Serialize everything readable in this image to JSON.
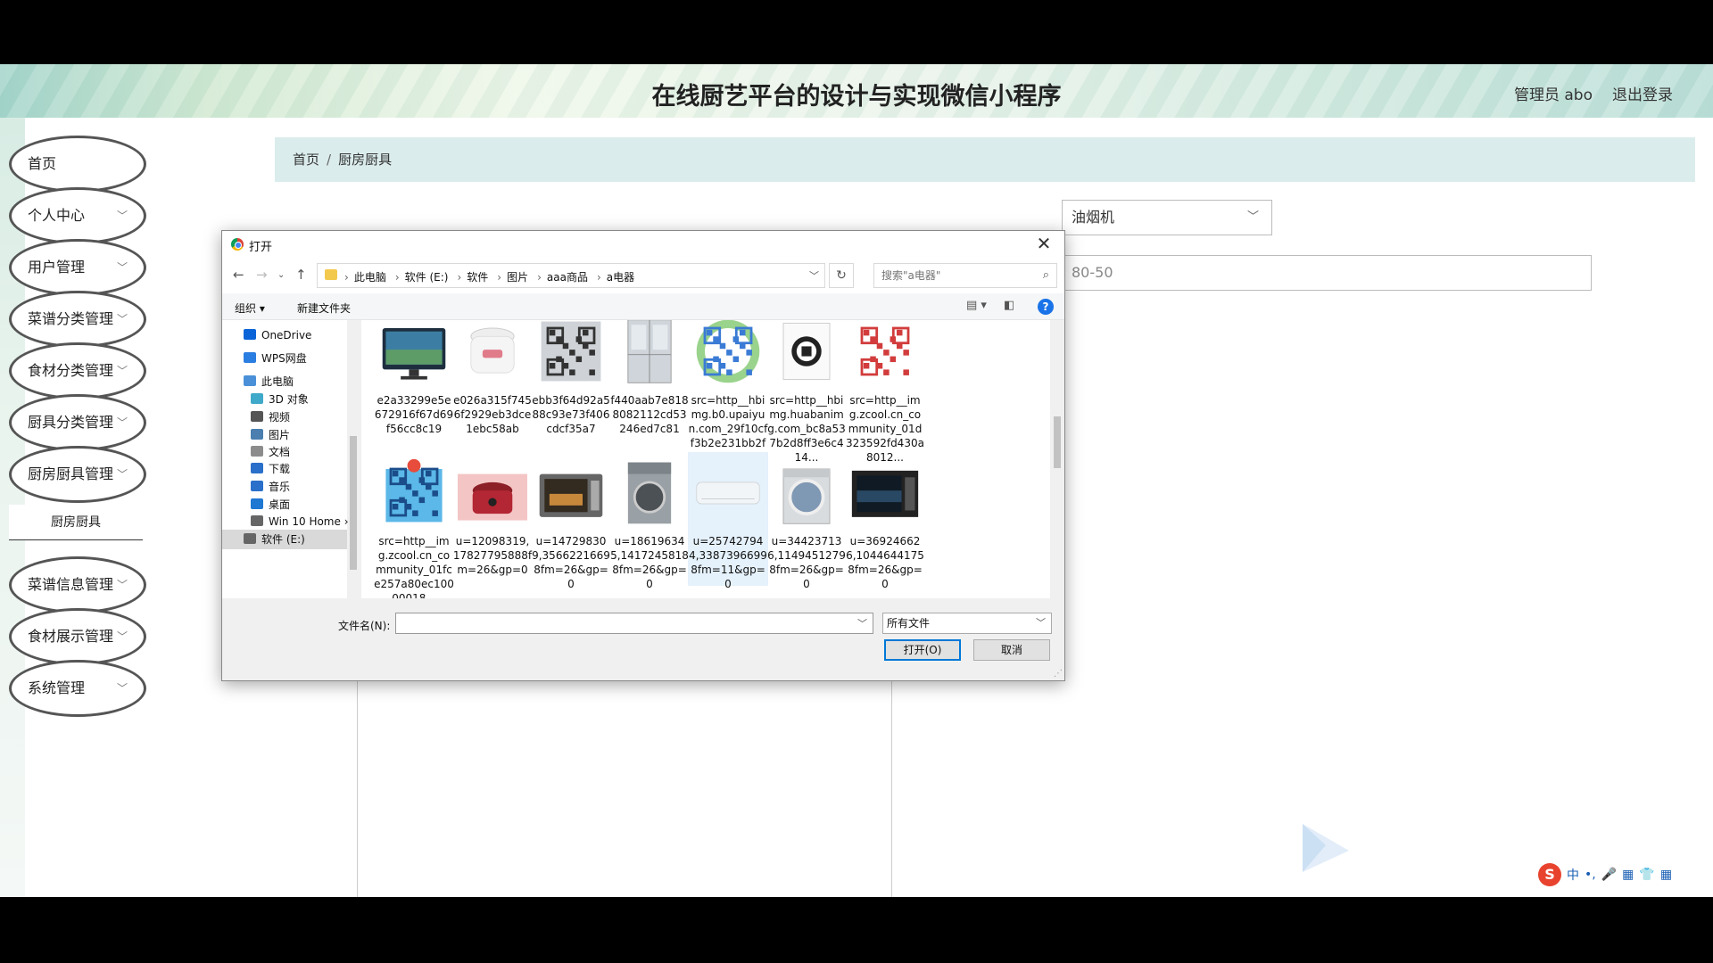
{
  "header": {
    "title": "在线厨艺平台的设计与实现微信小程序",
    "user_label": "管理员 abo",
    "logout_label": "退出登录"
  },
  "sidebar": {
    "items": [
      {
        "label": "首页",
        "has_chevron": false
      },
      {
        "label": "个人中心",
        "has_chevron": true
      },
      {
        "label": "用户管理",
        "has_chevron": true
      },
      {
        "label": "菜谱分类管理",
        "has_chevron": true
      },
      {
        "label": "食材分类管理",
        "has_chevron": true
      },
      {
        "label": "厨具分类管理",
        "has_chevron": true
      },
      {
        "label": "厨房厨具管理",
        "has_chevron": true
      },
      {
        "label": "菜谱信息管理",
        "has_chevron": true
      },
      {
        "label": "食材展示管理",
        "has_chevron": true
      },
      {
        "label": "系统管理",
        "has_chevron": true
      }
    ],
    "subitem": "厨房厨具"
  },
  "breadcrumb": {
    "home": "首页",
    "sep": "/",
    "current": "厨房厨具"
  },
  "form": {
    "select_value": "油烟机",
    "input_value": "80-50"
  },
  "dialog": {
    "title": "打开",
    "path": [
      "此电脑",
      "软件 (E:)",
      "软件",
      "图片",
      "aaa商品",
      "a电器"
    ],
    "search_placeholder": "搜索\"a电器\"",
    "organize": "组织 ▾",
    "new_folder": "新建文件夹",
    "nav": [
      {
        "label": "OneDrive",
        "color": "#0a64d8"
      },
      {
        "label": "WPS网盘",
        "color": "#2a7de1"
      },
      {
        "label": "此电脑",
        "color": "#4a90d9"
      },
      {
        "label": "3D 对象",
        "color": "#3fa9c9"
      },
      {
        "label": "视频",
        "color": "#555555"
      },
      {
        "label": "图片",
        "color": "#4a7fb0"
      },
      {
        "label": "文档",
        "color": "#8c8c8c"
      },
      {
        "label": "下载",
        "color": "#2a6fc9"
      },
      {
        "label": "音乐",
        "color": "#2a6fc9"
      },
      {
        "label": "桌面",
        "color": "#1f78d1"
      },
      {
        "label": "Win 10 Home ›",
        "color": "#666666"
      },
      {
        "label": "软件 (E:)",
        "color": "#666666"
      }
    ],
    "files": [
      {
        "name": "e2a33299e5e672916f67d69f56cc8c19",
        "kind": "monitor"
      },
      {
        "name": "e026a315f7456f2929eb3dce1ebc58ab",
        "kind": "cooker"
      },
      {
        "name": "ebb3f64d92a588c93e73f406cdcf35a7",
        "kind": "qr"
      },
      {
        "name": "f440aab7e8188082112cd53246ed7c81",
        "kind": "fridge"
      },
      {
        "name": "src=http__hbimg.b0.upaiyun.com_29f10cff3b2e231bb2fc09...",
        "kind": "qrcolor"
      },
      {
        "name": "src=http__hbimg.huabanimg.com_bc8a537b2d8ff3e6c414...",
        "kind": "qrpaper"
      },
      {
        "name": "src=http__img.zcool.cn_community_01d323592fd430a8012...",
        "kind": "qrred"
      },
      {
        "name": "src=http__img.zcool.cn_community_01fce257a80ec10000018...",
        "kind": "qrblue"
      },
      {
        "name": "u=12098319,17827795888fm=26&gp=0",
        "kind": "ricecooker"
      },
      {
        "name": "u=147298309,35662216698fm=26&gp=0",
        "kind": "microwave"
      },
      {
        "name": "u=186196345,14172458188fm=26&gp=0",
        "kind": "washer"
      },
      {
        "name": "u=257427944,33873966998fm=11&gp=0",
        "kind": "ac"
      },
      {
        "name": "u=344237136,11494512798fm=26&gp=0",
        "kind": "washer2"
      },
      {
        "name": "u=369246626,10446441758fm=26&gp=0",
        "kind": "oven"
      }
    ],
    "filename_label": "文件名(N):",
    "filename_value": "",
    "filetype": "所有文件",
    "open_button": "打开(O)",
    "cancel_button": "取消"
  },
  "ime": {
    "logo": "S",
    "items": [
      "中",
      "•,",
      "🎤",
      "▦",
      "👕",
      "▦"
    ]
  },
  "colors": {
    "accent": "#0078d7",
    "breadcrumb_bg": "#dbecec"
  }
}
